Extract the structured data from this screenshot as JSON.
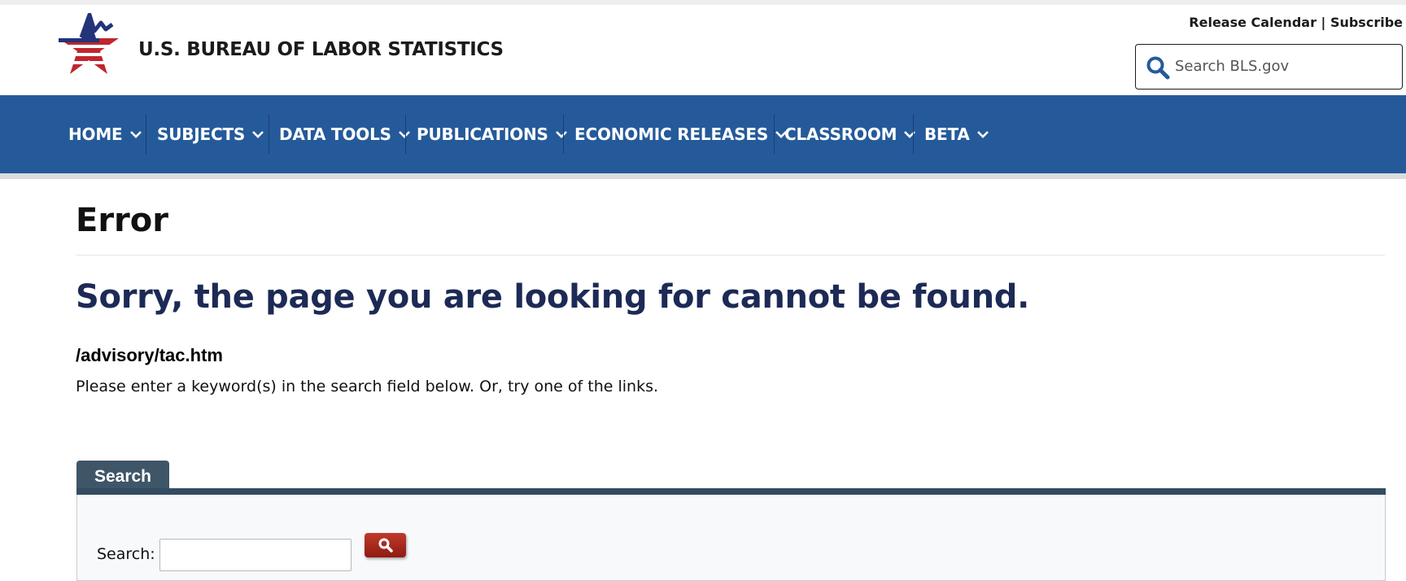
{
  "header": {
    "agency_name": "U.S. BUREAU OF LABOR STATISTICS",
    "utility_links": [
      "Release Calendar",
      "Subscribe"
    ],
    "utility_separator": " | ",
    "search_placeholder": "Search BLS.gov"
  },
  "nav": {
    "items": [
      {
        "label": "HOME"
      },
      {
        "label": "SUBJECTS"
      },
      {
        "label": "DATA TOOLS"
      },
      {
        "label": "PUBLICATIONS"
      },
      {
        "label": "ECONOMIC RELEASES"
      },
      {
        "label": "CLASSROOM"
      },
      {
        "label": "BETA"
      }
    ]
  },
  "main": {
    "title": "Error",
    "heading": "Sorry, the page you are looking for cannot be found.",
    "path": "/advisory/tac.htm",
    "instructions": "Please enter a keyword(s) in the search field below. Or, try one of the links."
  },
  "search_panel": {
    "tab_label": "Search",
    "field_label": "Search:",
    "field_value": ""
  },
  "colors": {
    "nav_blue": "#255a9a",
    "heading_navy": "#1c2a55",
    "tab_slate": "#3f5568",
    "button_red": "#a8271d"
  }
}
